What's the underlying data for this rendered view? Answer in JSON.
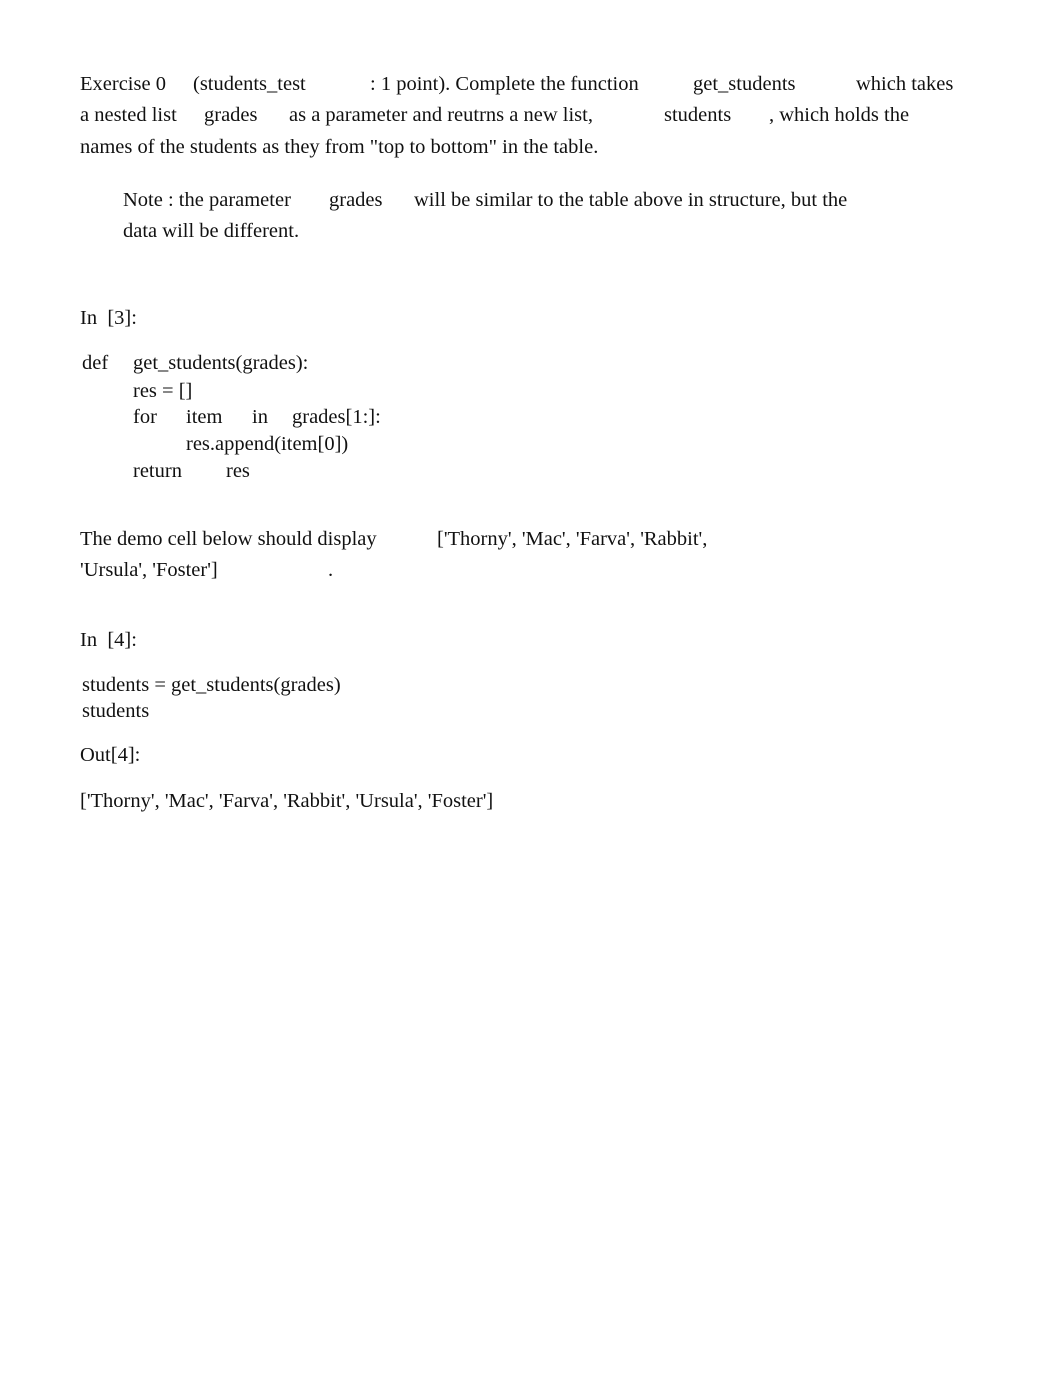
{
  "exercise": {
    "line1": {
      "a": "Exercise 0",
      "b": "(students_test",
      "c": ": 1 point). Complete the function",
      "d": "get_students",
      "e": "which takes"
    },
    "line2": {
      "a": "a nested list",
      "b": "grades",
      "c": "as a parameter and reutrns a new list,",
      "d": "students",
      "e": ", which holds the"
    },
    "line3": "names of the students as they from \"top to bottom\" in the table."
  },
  "note": {
    "line1": {
      "a": "Note : the parameter",
      "b": "grades",
      "c": "will be similar to the table above in structure, but the"
    },
    "line2": "data will be different."
  },
  "cell3": {
    "prompt": "In  [3]:",
    "code": [
      {
        "tokens": [
          "def",
          "get_students(grades):"
        ]
      },
      {
        "tokens": [
          "res = []"
        ]
      },
      {
        "tokens": [
          "for",
          "item",
          "in",
          "grades[1:]:"
        ]
      },
      {
        "tokens": [
          "res.append(item[0])"
        ]
      },
      {
        "tokens": [
          "return",
          "res"
        ]
      }
    ]
  },
  "demo": {
    "line1": {
      "a": "The demo cell below should display",
      "b": "['Thorny', 'Mac', 'Farva', 'Rabbit',"
    },
    "line2": {
      "a": "'Ursula', 'Foster']",
      "b": "."
    }
  },
  "cell4": {
    "prompt": "In  [4]:",
    "code": [
      "students = get_students(grades)",
      "students"
    ],
    "out_prompt": "Out[4]:",
    "output": "['Thorny', 'Mac', 'Farva', 'Rabbit', 'Ursula', 'Foster']"
  }
}
